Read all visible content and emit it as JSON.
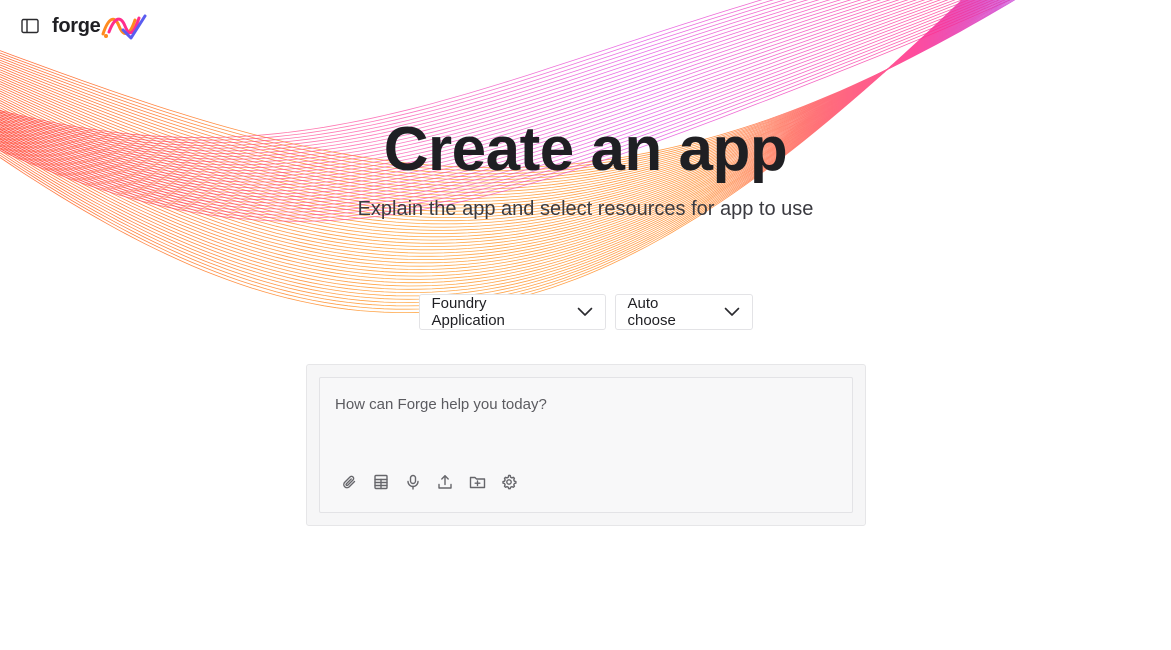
{
  "brand": {
    "name": "forge",
    "accent_colors": [
      "#ff8a1f",
      "#ff2d8c",
      "#b23df0",
      "#5a7dff"
    ]
  },
  "header": {
    "sidebar_toggle_icon": "sidebar-panel-icon"
  },
  "hero": {
    "title": "Create an app",
    "subtitle": "Explain the app and select resources for app to use"
  },
  "selectors": {
    "app_type": {
      "value": "Foundry Application",
      "icon": "chevron-down-icon"
    },
    "model": {
      "value": "Auto choose",
      "icon": "chevron-down-icon"
    }
  },
  "composer": {
    "placeholder": "How can Forge help you today?",
    "value": "",
    "tools": [
      {
        "name": "paperclip-icon"
      },
      {
        "name": "table-icon"
      },
      {
        "name": "microphone-icon"
      },
      {
        "name": "upload-icon"
      },
      {
        "name": "folder-plus-icon"
      },
      {
        "name": "gear-icon"
      }
    ]
  }
}
